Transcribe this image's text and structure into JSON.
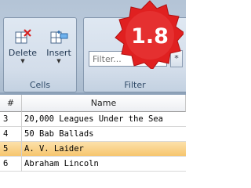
{
  "ribbon": {
    "groups": [
      {
        "label": "Cells"
      },
      {
        "label": "Filter"
      }
    ],
    "buttons": {
      "delete": "Delete",
      "insert": "Insert"
    },
    "filter": {
      "placeholder": "Filter...",
      "clear_label": "*"
    }
  },
  "badge": {
    "text": "1.8"
  },
  "grid": {
    "columns": [
      "#",
      "Name"
    ],
    "rows": [
      {
        "num": "3",
        "name": "20,000 Leagues Under the Sea"
      },
      {
        "num": "4",
        "name": "50 Bab Ballads"
      },
      {
        "num": "5",
        "name": "A. V. Laider",
        "selected": true
      },
      {
        "num": "6",
        "name": "Abraham Lincoln"
      }
    ]
  },
  "colors": {
    "badge": "#e02020",
    "selected_row": "#f6c56e",
    "ribbon": "#bccbdc"
  }
}
